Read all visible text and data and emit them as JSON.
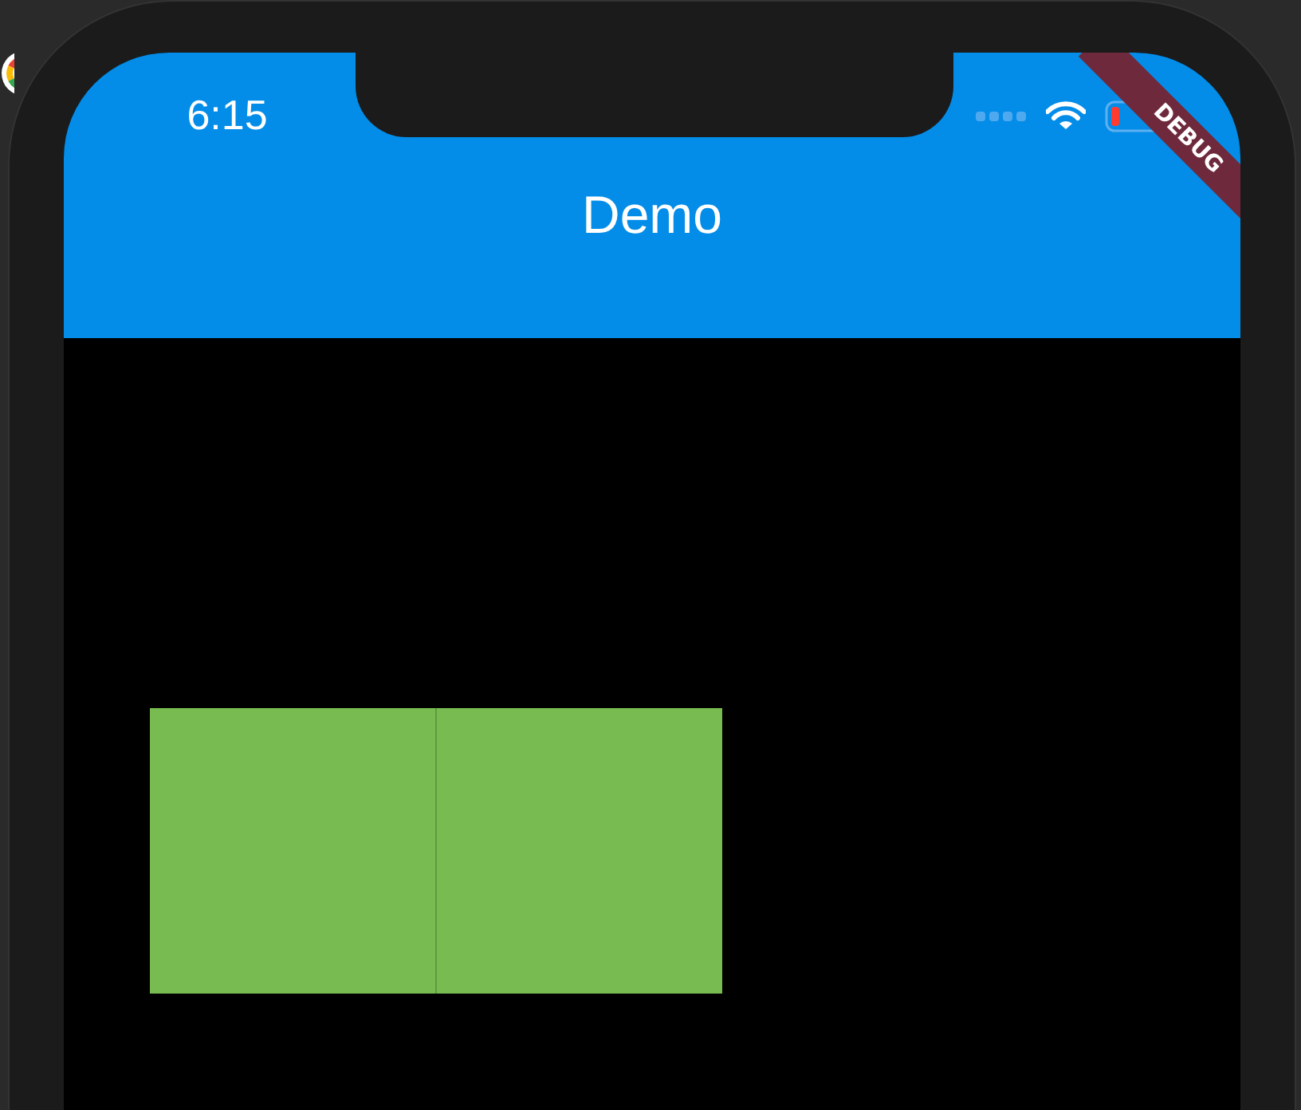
{
  "status_bar": {
    "time": "6:15"
  },
  "app_bar": {
    "title": "Demo"
  },
  "debug_banner": {
    "label": "DEBUG"
  },
  "blocks": [
    {
      "kind": "square",
      "color": "#78bb50"
    },
    {
      "kind": "square",
      "color": "#78bb50"
    }
  ]
}
